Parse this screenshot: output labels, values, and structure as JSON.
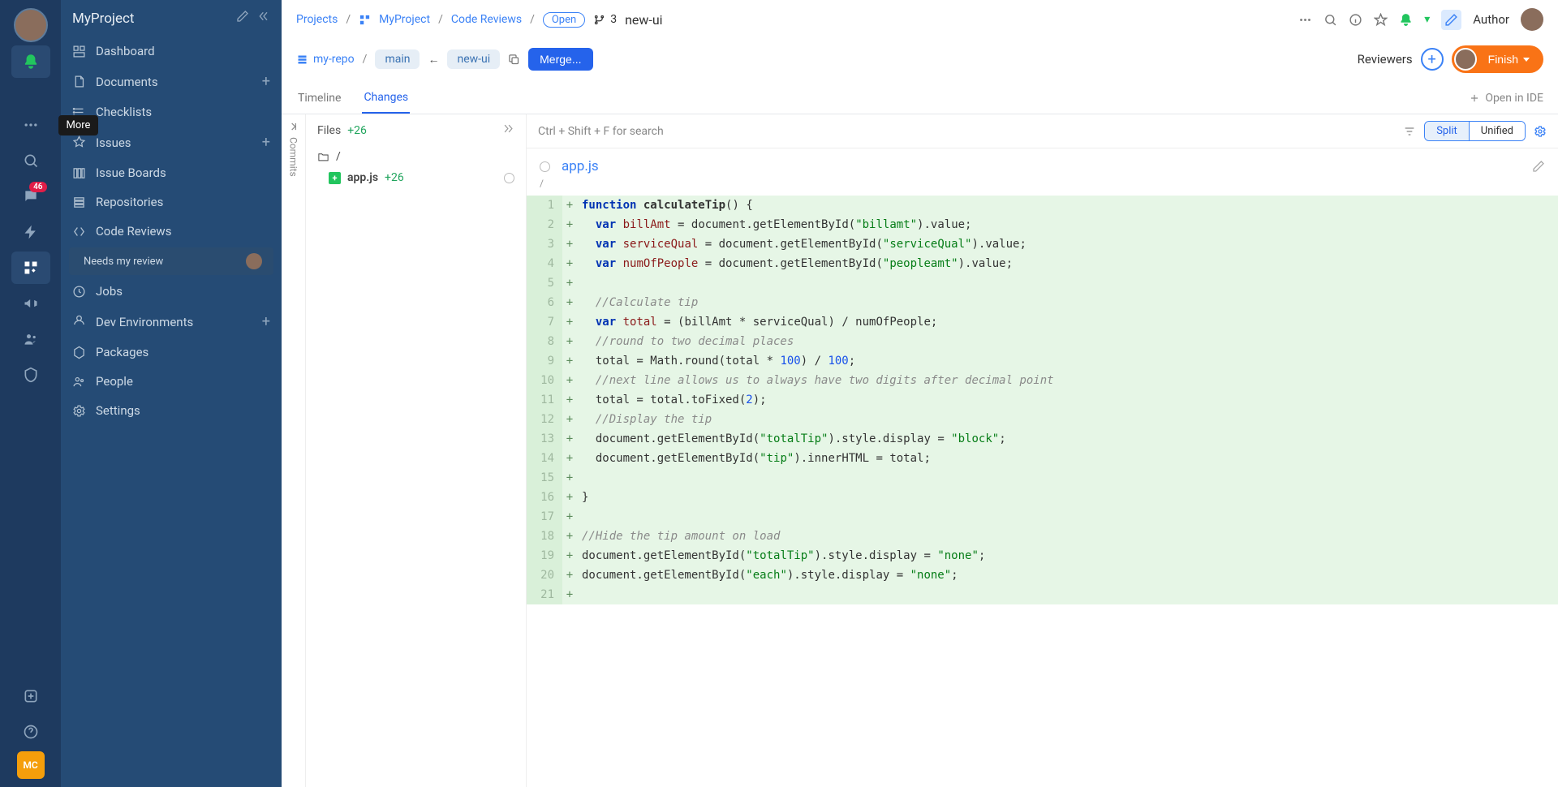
{
  "activity": {
    "tooltip_more": "More",
    "chat_badge": "46",
    "mc_label": "MC"
  },
  "sidebar": {
    "title": "MyProject",
    "items": [
      {
        "label": "Dashboard"
      },
      {
        "label": "Documents",
        "add": true
      },
      {
        "label": "Checklists"
      },
      {
        "label": "Issues",
        "add": true
      },
      {
        "label": "Issue Boards"
      },
      {
        "label": "Repositories"
      },
      {
        "label": "Code Reviews"
      },
      {
        "label": "Jobs"
      },
      {
        "label": "Dev Environments",
        "add": true
      },
      {
        "label": "Packages"
      },
      {
        "label": "People"
      },
      {
        "label": "Settings"
      }
    ],
    "sub_review": "Needs my review"
  },
  "breadcrumb": {
    "projects": "Projects",
    "project": "MyProject",
    "section": "Code Reviews",
    "status": "Open",
    "branch_num": "3",
    "branch_name": "new-ui",
    "author_label": "Author"
  },
  "repo": {
    "name": "my-repo",
    "target": "main",
    "source": "new-ui",
    "merge_label": "Merge...",
    "reviewers_label": "Reviewers",
    "finish_label": "Finish"
  },
  "tabs": {
    "timeline": "Timeline",
    "changes": "Changes",
    "open_ide": "Open in IDE"
  },
  "commits": {
    "label": "Commits"
  },
  "files": {
    "header": "Files",
    "count": "+26",
    "root": "/",
    "file_name": "app.js",
    "file_diff": "+26"
  },
  "toolbar": {
    "search_hint": "Ctrl + Shift + F for search",
    "split": "Split",
    "unified": "Unified"
  },
  "filehdr": {
    "name": "app.js",
    "path": "/"
  },
  "code": {
    "lines": [
      {
        "n": 1,
        "s": "+",
        "html": "<span class='kw'>function</span> <span class='fn'>calculateTip</span>() {"
      },
      {
        "n": 2,
        "s": "+",
        "html": "  <span class='kw'>var</span> <span class='var'>billAmt</span> = document.getElementById(<span class='str'>\"billamt\"</span>).value;"
      },
      {
        "n": 3,
        "s": "+",
        "html": "  <span class='kw'>var</span> <span class='var'>serviceQual</span> = document.getElementById(<span class='str'>\"serviceQual\"</span>).value;"
      },
      {
        "n": 4,
        "s": "+",
        "html": "  <span class='kw'>var</span> <span class='var'>numOfPeople</span> = document.getElementById(<span class='str'>\"peopleamt\"</span>).value;"
      },
      {
        "n": 5,
        "s": "+",
        "html": ""
      },
      {
        "n": 6,
        "s": "+",
        "html": "  <span class='cm'>//Calculate tip</span>"
      },
      {
        "n": 7,
        "s": "+",
        "html": "  <span class='kw'>var</span> <span class='var'>total</span> = (billAmt * serviceQual) / numOfPeople;"
      },
      {
        "n": 8,
        "s": "+",
        "html": "  <span class='cm'>//round to two decimal places</span>"
      },
      {
        "n": 9,
        "s": "+",
        "html": "  total = Math.round(total * <span class='num'>100</span>) / <span class='num'>100</span>;"
      },
      {
        "n": 10,
        "s": "+",
        "html": "  <span class='cm'>//next line allows us to always have two digits after decimal point</span>"
      },
      {
        "n": 11,
        "s": "+",
        "html": "  total = total.toFixed(<span class='num'>2</span>);"
      },
      {
        "n": 12,
        "s": "+",
        "html": "  <span class='cm'>//Display the tip</span>"
      },
      {
        "n": 13,
        "s": "+",
        "html": "  document.getElementById(<span class='str'>\"totalTip\"</span>).style.display = <span class='str'>\"block\"</span>;"
      },
      {
        "n": 14,
        "s": "+",
        "html": "  document.getElementById(<span class='str'>\"tip\"</span>).innerHTML = total;"
      },
      {
        "n": 15,
        "s": "+",
        "html": ""
      },
      {
        "n": 16,
        "s": "+",
        "html": "}"
      },
      {
        "n": 17,
        "s": "+",
        "html": ""
      },
      {
        "n": 18,
        "s": "+",
        "html": "<span class='cm'>//Hide the tip amount on load</span>"
      },
      {
        "n": 19,
        "s": "+",
        "html": "document.getElementById(<span class='str'>\"totalTip\"</span>).style.display = <span class='str'>\"none\"</span>;"
      },
      {
        "n": 20,
        "s": "+",
        "html": "document.getElementById(<span class='str'>\"each\"</span>).style.display = <span class='str'>\"none\"</span>;"
      },
      {
        "n": 21,
        "s": "+",
        "html": ""
      }
    ]
  }
}
